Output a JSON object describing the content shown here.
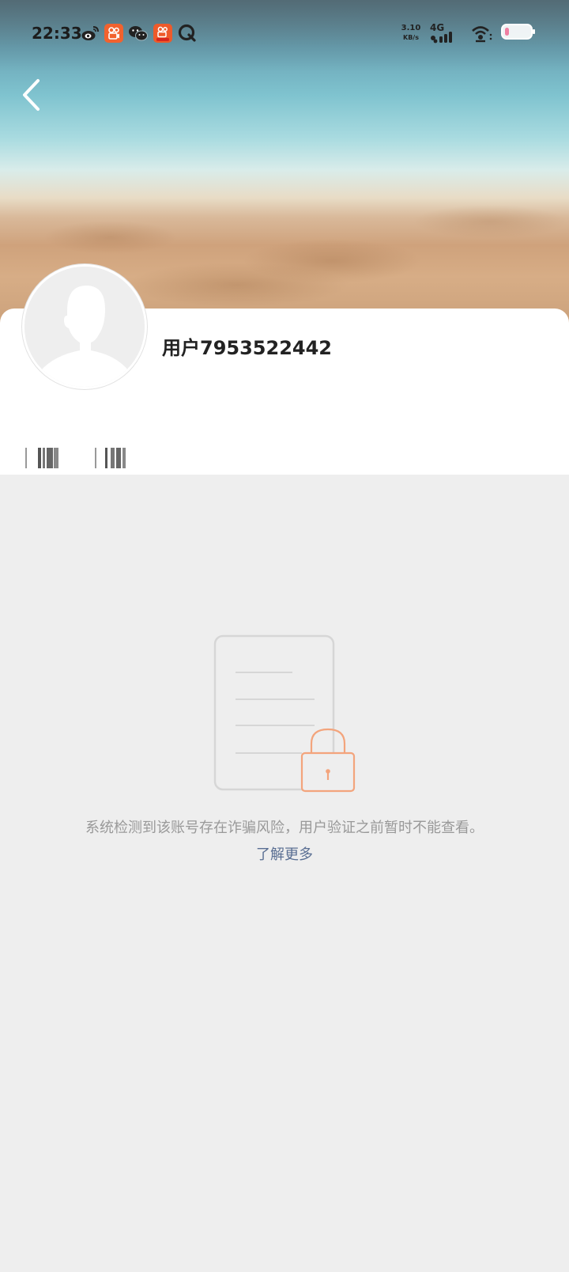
{
  "status_bar": {
    "time": "22:33",
    "net_speed_value": "3.10",
    "net_speed_unit": "KB/s",
    "network_type": "4G",
    "battery_level": 0.15,
    "icons": [
      "weibo-icon",
      "kuaishou-icon",
      "wechat-icon",
      "kuaishou-lite-icon",
      "quark-icon",
      "signal-icon",
      "hotspot-icon",
      "battery-icon"
    ]
  },
  "header": {
    "back_icon": "chevron-left-icon",
    "cover_image": "beach-sand-photo"
  },
  "profile": {
    "username": "用户7953522442",
    "avatar": "default-avatar-silhouette"
  },
  "locked_notice": {
    "message": "系统检测到该账号存在诈骗风险，用户验证之前暂时不能查看。",
    "link_label": "了解更多"
  },
  "colors": {
    "page_background": "#eeeeee",
    "card_background": "#ffffff",
    "link": "#5a6f93",
    "lock_accent": "#f3a47c",
    "muted_text": "#999999"
  }
}
